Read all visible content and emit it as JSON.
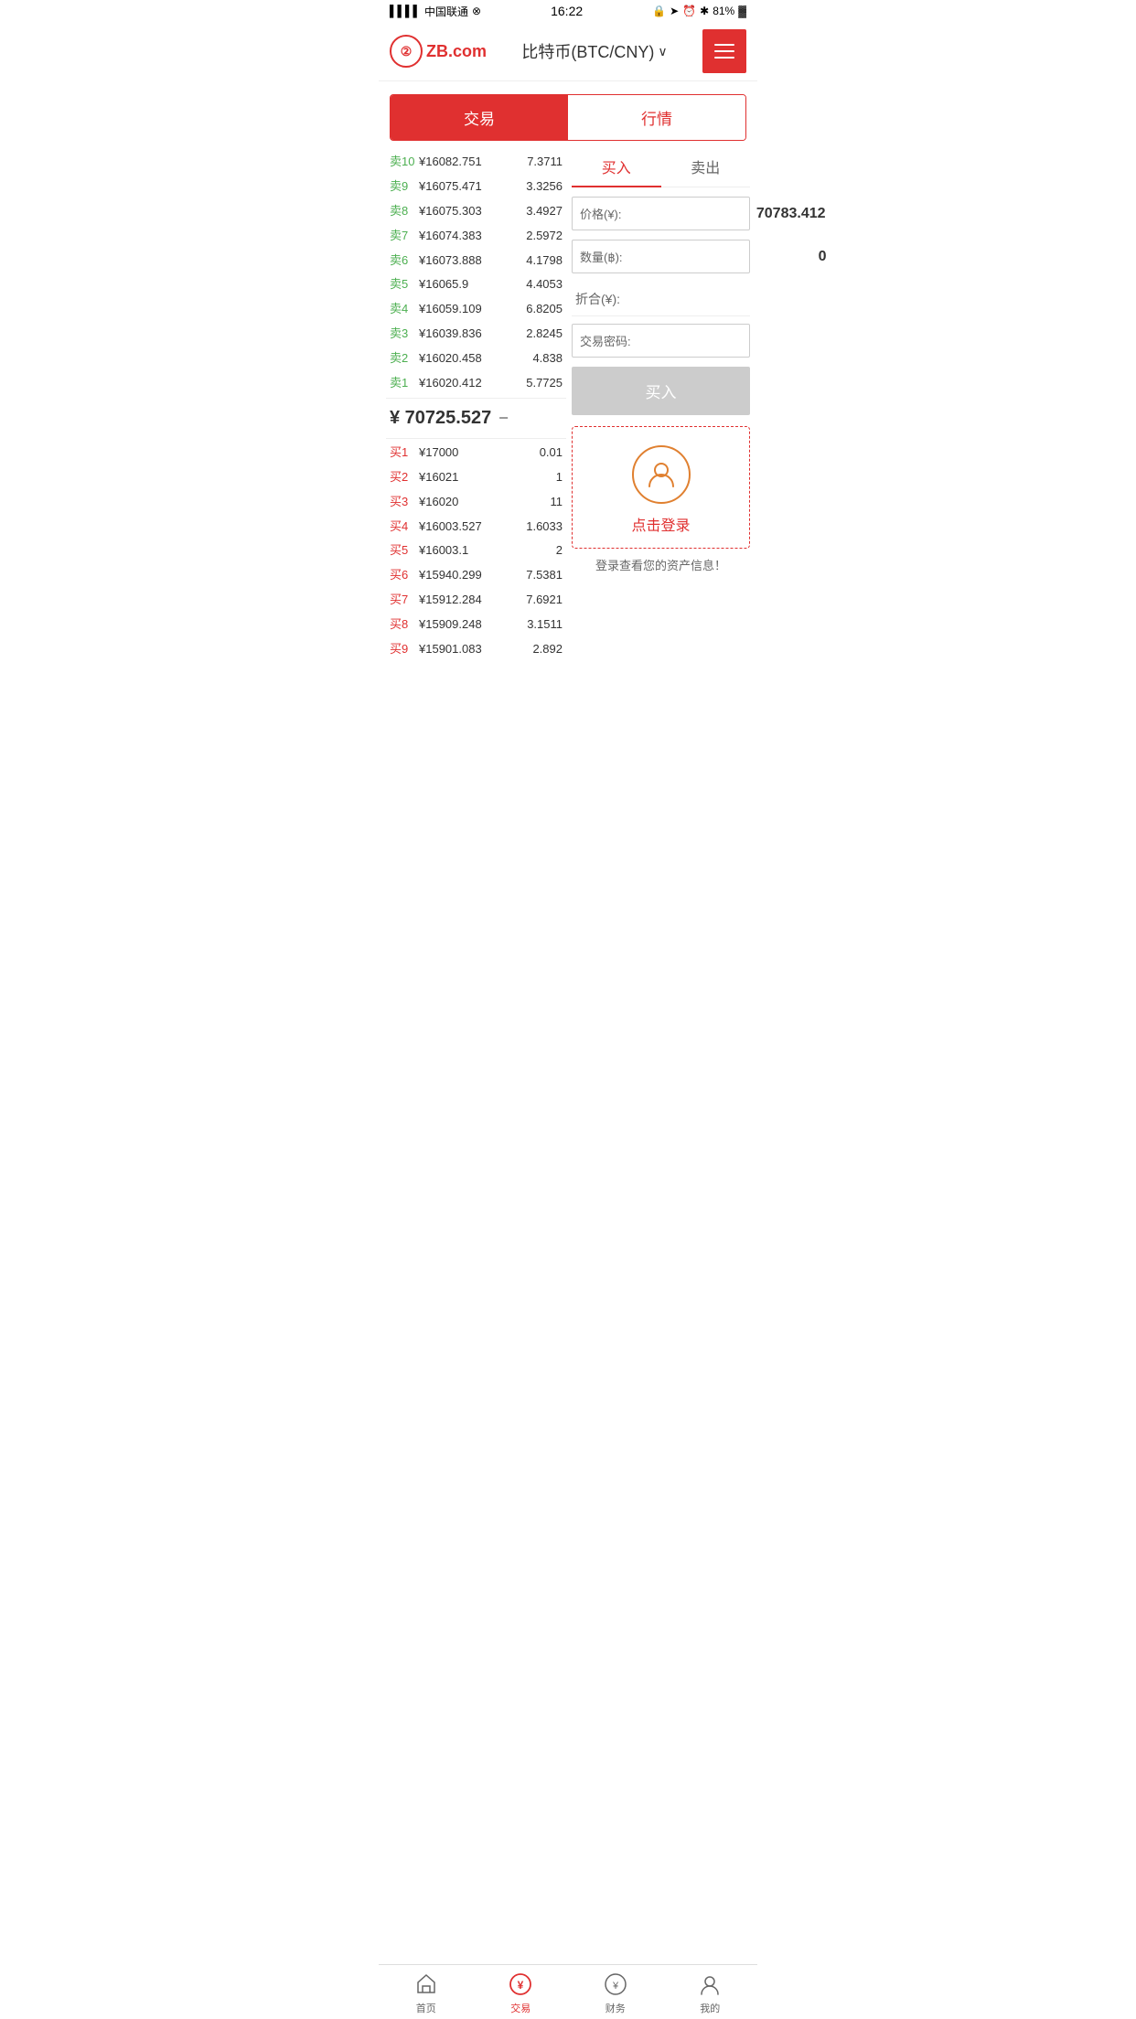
{
  "statusBar": {
    "carrier": "中国联通",
    "time": "16:22",
    "battery": "81%"
  },
  "header": {
    "logoText": "ZB.com",
    "title": "比特币(BTC/CNY)",
    "menuLabel": "menu"
  },
  "mainTabs": [
    {
      "id": "trade",
      "label": "交易",
      "active": true
    },
    {
      "id": "market",
      "label": "行情",
      "active": false
    }
  ],
  "buySellTabs": [
    {
      "id": "buy",
      "label": "买入",
      "active": true
    },
    {
      "id": "sell",
      "label": "卖出",
      "active": false
    }
  ],
  "sellOrders": [
    {
      "side": "卖10",
      "price": "¥16082.751",
      "qty": "7.3711"
    },
    {
      "side": "卖9",
      "price": "¥16075.471",
      "qty": "3.3256"
    },
    {
      "side": "卖8",
      "price": "¥16075.303",
      "qty": "3.4927"
    },
    {
      "side": "卖7",
      "price": "¥16074.383",
      "qty": "2.5972"
    },
    {
      "side": "卖6",
      "price": "¥16073.888",
      "qty": "4.1798"
    },
    {
      "side": "卖5",
      "price": "¥16065.9",
      "qty": "4.4053"
    },
    {
      "side": "卖4",
      "price": "¥16059.109",
      "qty": "6.8205"
    },
    {
      "side": "卖3",
      "price": "¥16039.836",
      "qty": "2.8245"
    },
    {
      "side": "卖2",
      "price": "¥16020.458",
      "qty": "4.838"
    },
    {
      "side": "卖1",
      "price": "¥16020.412",
      "qty": "5.7725"
    }
  ],
  "midPrice": {
    "value": "¥ 70725.527",
    "icon": "−"
  },
  "buyOrders": [
    {
      "side": "买1",
      "price": "¥17000",
      "qty": "0.01"
    },
    {
      "side": "买2",
      "price": "¥16021",
      "qty": "1"
    },
    {
      "side": "买3",
      "price": "¥16020",
      "qty": "11"
    },
    {
      "side": "买4",
      "price": "¥16003.527",
      "qty": "1.6033"
    },
    {
      "side": "买5",
      "price": "¥16003.1",
      "qty": "2"
    },
    {
      "side": "买6",
      "price": "¥15940.299",
      "qty": "7.5381"
    },
    {
      "side": "买7",
      "price": "¥15912.284",
      "qty": "7.6921"
    },
    {
      "side": "买8",
      "price": "¥15909.248",
      "qty": "3.1511"
    },
    {
      "side": "买9",
      "price": "¥15901.083",
      "qty": "2.892"
    }
  ],
  "tradeForm": {
    "priceLabel": "价格(¥):",
    "priceValue": "70783.412",
    "qtyLabel": "数量(฿):",
    "qtyValue": "0",
    "totalLabel": "折合(¥):",
    "totalValue": "",
    "passwordLabel": "交易密码:",
    "passwordValue": "",
    "buyBtnLabel": "买入"
  },
  "loginBox": {
    "loginText": "点击登录",
    "hintText": "登录查看您的资产信息！"
  },
  "bottomNav": [
    {
      "id": "home",
      "label": "首页",
      "active": false
    },
    {
      "id": "trade",
      "label": "交易",
      "active": true
    },
    {
      "id": "finance",
      "label": "财务",
      "active": false
    },
    {
      "id": "profile",
      "label": "我的",
      "active": false
    }
  ]
}
